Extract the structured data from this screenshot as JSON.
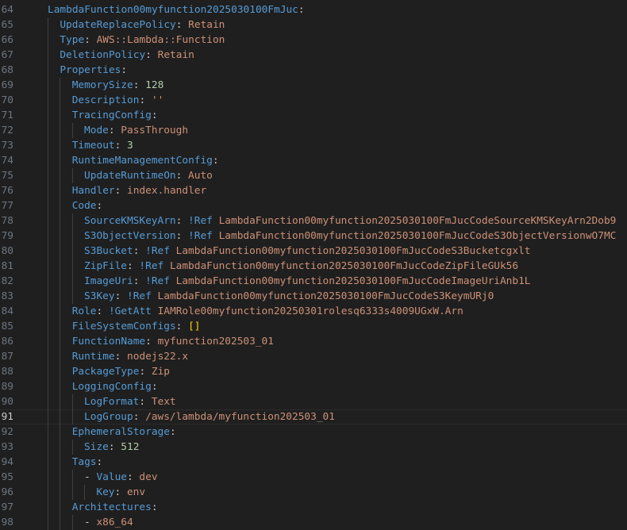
{
  "editor": {
    "colors": {
      "key": "#569cd6",
      "punctuation": "#cccccc",
      "string": "#ce9178",
      "number": "#b5cea8",
      "bracket": "#ffd700",
      "line_number": "#6e7681",
      "background": "#1f1f1f"
    },
    "current_line": "91",
    "lines": [
      {
        "num": "64",
        "depth": 0,
        "tokens": [
          {
            "t": "LambdaFunction00myfunction2025030100FmJuc",
            "c": "key"
          },
          {
            "t": ":",
            "c": "punc"
          }
        ]
      },
      {
        "num": "65",
        "depth": 1,
        "tokens": [
          {
            "t": "UpdateReplacePolicy",
            "c": "key"
          },
          {
            "t": ": ",
            "c": "punc"
          },
          {
            "t": "Retain",
            "c": "str"
          }
        ]
      },
      {
        "num": "66",
        "depth": 1,
        "tokens": [
          {
            "t": "Type",
            "c": "key"
          },
          {
            "t": ": ",
            "c": "punc"
          },
          {
            "t": "AWS::Lambda::Function",
            "c": "str"
          }
        ]
      },
      {
        "num": "67",
        "depth": 1,
        "tokens": [
          {
            "t": "DeletionPolicy",
            "c": "key"
          },
          {
            "t": ": ",
            "c": "punc"
          },
          {
            "t": "Retain",
            "c": "str"
          }
        ]
      },
      {
        "num": "68",
        "depth": 1,
        "tokens": [
          {
            "t": "Properties",
            "c": "key"
          },
          {
            "t": ":",
            "c": "punc"
          }
        ]
      },
      {
        "num": "69",
        "depth": 2,
        "tokens": [
          {
            "t": "MemorySize",
            "c": "key"
          },
          {
            "t": ": ",
            "c": "punc"
          },
          {
            "t": "128",
            "c": "num"
          }
        ]
      },
      {
        "num": "70",
        "depth": 2,
        "tokens": [
          {
            "t": "Description",
            "c": "key"
          },
          {
            "t": ": ",
            "c": "punc"
          },
          {
            "t": "''",
            "c": "str"
          }
        ]
      },
      {
        "num": "71",
        "depth": 2,
        "tokens": [
          {
            "t": "TracingConfig",
            "c": "key"
          },
          {
            "t": ":",
            "c": "punc"
          }
        ]
      },
      {
        "num": "72",
        "depth": 3,
        "tokens": [
          {
            "t": "Mode",
            "c": "key"
          },
          {
            "t": ": ",
            "c": "punc"
          },
          {
            "t": "PassThrough",
            "c": "str"
          }
        ]
      },
      {
        "num": "73",
        "depth": 2,
        "tokens": [
          {
            "t": "Timeout",
            "c": "key"
          },
          {
            "t": ": ",
            "c": "punc"
          },
          {
            "t": "3",
            "c": "num"
          }
        ]
      },
      {
        "num": "74",
        "depth": 2,
        "tokens": [
          {
            "t": "RuntimeManagementConfig",
            "c": "key"
          },
          {
            "t": ":",
            "c": "punc"
          }
        ]
      },
      {
        "num": "75",
        "depth": 3,
        "tokens": [
          {
            "t": "UpdateRuntimeOn",
            "c": "key"
          },
          {
            "t": ": ",
            "c": "punc"
          },
          {
            "t": "Auto",
            "c": "str"
          }
        ]
      },
      {
        "num": "76",
        "depth": 2,
        "tokens": [
          {
            "t": "Handler",
            "c": "key"
          },
          {
            "t": ": ",
            "c": "punc"
          },
          {
            "t": "index.handler",
            "c": "str"
          }
        ]
      },
      {
        "num": "77",
        "depth": 2,
        "tokens": [
          {
            "t": "Code",
            "c": "key"
          },
          {
            "t": ":",
            "c": "punc"
          }
        ]
      },
      {
        "num": "78",
        "depth": 3,
        "tokens": [
          {
            "t": "SourceKMSKeyArn",
            "c": "key"
          },
          {
            "t": ": ",
            "c": "punc"
          },
          {
            "t": "!Ref",
            "c": "key"
          },
          {
            "t": " LambdaFunction00myfunction2025030100FmJucCodeSourceKMSKeyArn2Dob9",
            "c": "str"
          }
        ]
      },
      {
        "num": "79",
        "depth": 3,
        "tokens": [
          {
            "t": "S3ObjectVersion",
            "c": "key"
          },
          {
            "t": ": ",
            "c": "punc"
          },
          {
            "t": "!Ref",
            "c": "key"
          },
          {
            "t": " LambdaFunction00myfunction2025030100FmJucCodeS3ObjectVersionwO7MC",
            "c": "str"
          }
        ]
      },
      {
        "num": "80",
        "depth": 3,
        "tokens": [
          {
            "t": "S3Bucket",
            "c": "key"
          },
          {
            "t": ": ",
            "c": "punc"
          },
          {
            "t": "!Ref",
            "c": "key"
          },
          {
            "t": " LambdaFunction00myfunction2025030100FmJucCodeS3Bucketcgxlt",
            "c": "str"
          }
        ]
      },
      {
        "num": "81",
        "depth": 3,
        "tokens": [
          {
            "t": "ZipFile",
            "c": "key"
          },
          {
            "t": ": ",
            "c": "punc"
          },
          {
            "t": "!Ref",
            "c": "key"
          },
          {
            "t": " LambdaFunction00myfunction2025030100FmJucCodeZipFileGUk56",
            "c": "str"
          }
        ]
      },
      {
        "num": "82",
        "depth": 3,
        "tokens": [
          {
            "t": "ImageUri",
            "c": "key"
          },
          {
            "t": ": ",
            "c": "punc"
          },
          {
            "t": "!Ref",
            "c": "key"
          },
          {
            "t": " LambdaFunction00myfunction2025030100FmJucCodeImageUriAnb1L",
            "c": "str"
          }
        ]
      },
      {
        "num": "83",
        "depth": 3,
        "tokens": [
          {
            "t": "S3Key",
            "c": "key"
          },
          {
            "t": ": ",
            "c": "punc"
          },
          {
            "t": "!Ref",
            "c": "key"
          },
          {
            "t": " LambdaFunction00myfunction2025030100FmJucCodeS3KeymURj0",
            "c": "str"
          }
        ]
      },
      {
        "num": "84",
        "depth": 2,
        "tokens": [
          {
            "t": "Role",
            "c": "key"
          },
          {
            "t": ": ",
            "c": "punc"
          },
          {
            "t": "!GetAtt",
            "c": "key"
          },
          {
            "t": " IAMRole00myfunction20250301rolesq6333s4009UGxW.Arn",
            "c": "str"
          }
        ]
      },
      {
        "num": "85",
        "depth": 2,
        "tokens": [
          {
            "t": "FileSystemConfigs",
            "c": "key"
          },
          {
            "t": ": ",
            "c": "punc"
          },
          {
            "t": "[]",
            "c": "brk"
          }
        ]
      },
      {
        "num": "86",
        "depth": 2,
        "tokens": [
          {
            "t": "FunctionName",
            "c": "key"
          },
          {
            "t": ": ",
            "c": "punc"
          },
          {
            "t": "myfunction202503_01",
            "c": "str"
          }
        ]
      },
      {
        "num": "87",
        "depth": 2,
        "tokens": [
          {
            "t": "Runtime",
            "c": "key"
          },
          {
            "t": ": ",
            "c": "punc"
          },
          {
            "t": "nodejs22.x",
            "c": "str"
          }
        ]
      },
      {
        "num": "88",
        "depth": 2,
        "tokens": [
          {
            "t": "PackageType",
            "c": "key"
          },
          {
            "t": ": ",
            "c": "punc"
          },
          {
            "t": "Zip",
            "c": "str"
          }
        ]
      },
      {
        "num": "89",
        "depth": 2,
        "tokens": [
          {
            "t": "LoggingConfig",
            "c": "key"
          },
          {
            "t": ":",
            "c": "punc"
          }
        ]
      },
      {
        "num": "90",
        "depth": 3,
        "tokens": [
          {
            "t": "LogFormat",
            "c": "key"
          },
          {
            "t": ": ",
            "c": "punc"
          },
          {
            "t": "Text",
            "c": "str"
          }
        ]
      },
      {
        "num": "91",
        "depth": 3,
        "tokens": [
          {
            "t": "LogGroup",
            "c": "key"
          },
          {
            "t": ": ",
            "c": "punc"
          },
          {
            "t": "/aws/lambda/myfunction202503_01",
            "c": "str"
          }
        ]
      },
      {
        "num": "92",
        "depth": 2,
        "tokens": [
          {
            "t": "EphemeralStorage",
            "c": "key"
          },
          {
            "t": ":",
            "c": "punc"
          }
        ]
      },
      {
        "num": "93",
        "depth": 3,
        "tokens": [
          {
            "t": "Size",
            "c": "key"
          },
          {
            "t": ": ",
            "c": "punc"
          },
          {
            "t": "512",
            "c": "num"
          }
        ]
      },
      {
        "num": "94",
        "depth": 2,
        "tokens": [
          {
            "t": "Tags",
            "c": "key"
          },
          {
            "t": ":",
            "c": "punc"
          }
        ]
      },
      {
        "num": "95",
        "depth": 3,
        "tokens": [
          {
            "t": "- ",
            "c": "punc"
          },
          {
            "t": "Value",
            "c": "key"
          },
          {
            "t": ": ",
            "c": "punc"
          },
          {
            "t": "dev",
            "c": "str"
          }
        ]
      },
      {
        "num": "96",
        "depth": 4,
        "tokens": [
          {
            "t": "Key",
            "c": "key"
          },
          {
            "t": ": ",
            "c": "punc"
          },
          {
            "t": "env",
            "c": "str"
          }
        ]
      },
      {
        "num": "97",
        "depth": 2,
        "tokens": [
          {
            "t": "Architectures",
            "c": "key"
          },
          {
            "t": ":",
            "c": "punc"
          }
        ]
      },
      {
        "num": "98",
        "depth": 3,
        "tokens": [
          {
            "t": "- ",
            "c": "punc"
          },
          {
            "t": "x86_64",
            "c": "str"
          }
        ]
      }
    ]
  }
}
